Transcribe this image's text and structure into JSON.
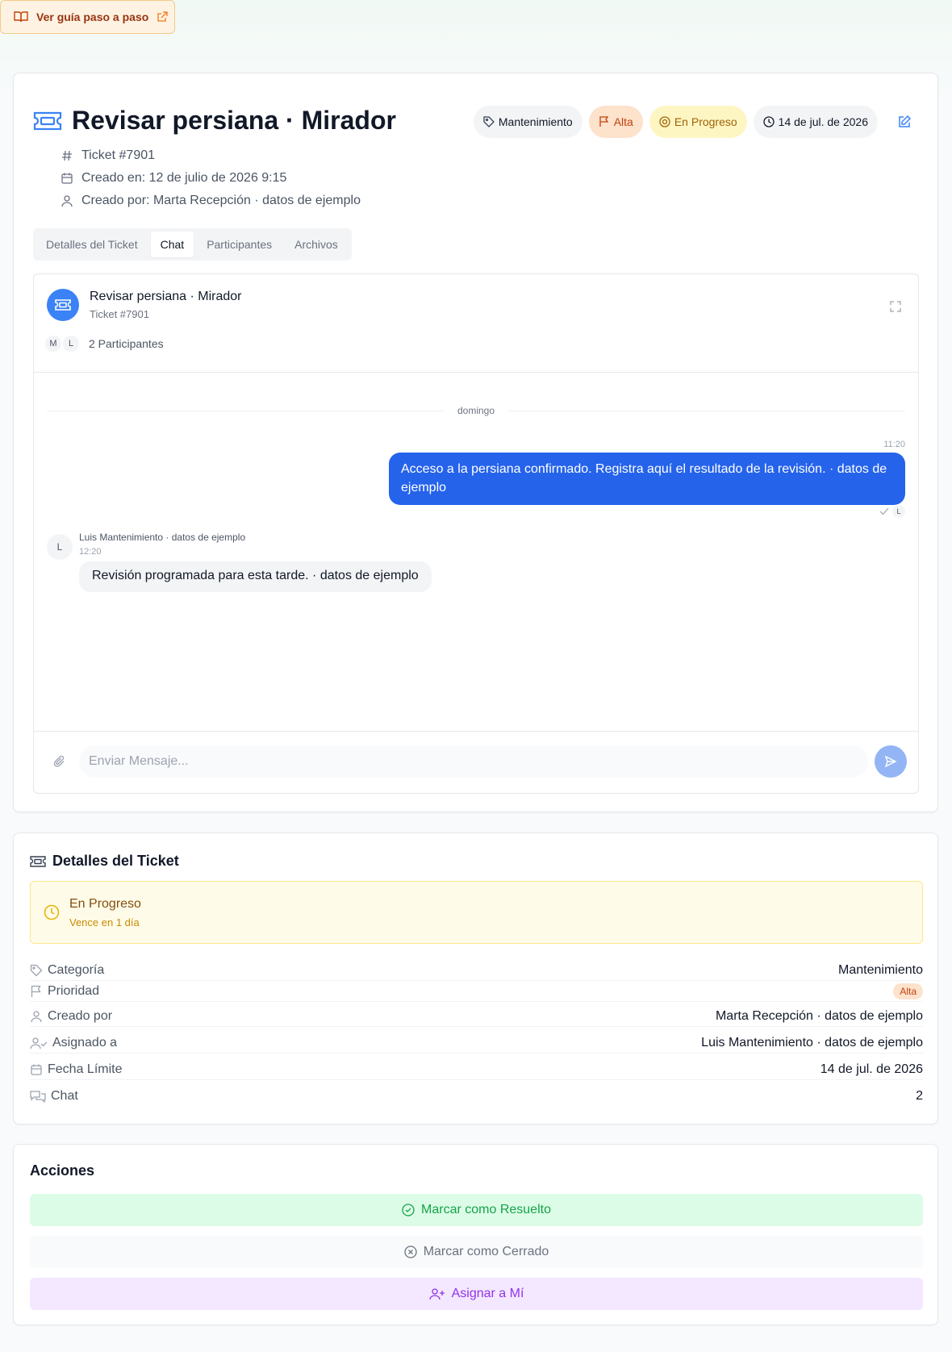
{
  "guide": {
    "label": "Ver guía paso a paso"
  },
  "ticket": {
    "title": "Revisar persiana · Mirador",
    "number": "Ticket #7901",
    "created_at": "Creado en: 12 de julio de 2026 9:15",
    "created_by": "Creado por: Marta Recepción · datos de ejemplo"
  },
  "badges": {
    "category": "Mantenimiento",
    "priority": "Alta",
    "status": "En Progreso",
    "due": "14 de jul. de 2026"
  },
  "tabs": [
    {
      "label": "Detalles del Ticket",
      "active": false
    },
    {
      "label": "Chat",
      "active": true
    },
    {
      "label": "Participantes",
      "active": false
    },
    {
      "label": "Archivos",
      "active": false
    }
  ],
  "chat": {
    "title": "Revisar persiana · Mirador",
    "subtitle": "Ticket #7901",
    "participants": [
      "M",
      "L"
    ],
    "participants_label": "2 Participantes",
    "day_label": "domingo",
    "messages": [
      {
        "direction": "out",
        "time": "11:20",
        "text": "Acceso a la persiana confirmado. Registra aquí el resultado de la revisión. · datos de ejemplo",
        "read_by": "L"
      },
      {
        "direction": "in",
        "avatar": "L",
        "author": "Luis Mantenimiento · datos de ejemplo",
        "time": "12:20",
        "text": "Revisión programada para esta tarde. · datos de ejemplo"
      }
    ],
    "input_placeholder": "Enviar Mensaje..."
  },
  "details": {
    "title": "Detalles del Ticket",
    "status_title": "En Progreso",
    "status_sub": "Vence en 1 día",
    "rows": [
      {
        "label": "Categoría",
        "value": "Mantenimiento"
      },
      {
        "label": "Prioridad",
        "value": "Alta"
      },
      {
        "label": "Creado por",
        "value": "Marta Recepción · datos de ejemplo"
      },
      {
        "label": "Asignado a",
        "value": "Luis Mantenimiento · datos de ejemplo"
      },
      {
        "label": "Fecha Límite",
        "value": "14 de jul. de 2026"
      },
      {
        "label": "Chat",
        "value": "2"
      }
    ]
  },
  "actions": {
    "title": "Acciones",
    "resolve": "Marcar como Resuelto",
    "close": "Marcar como Cerrado",
    "assign": "Asignar a Mí"
  },
  "colors": {
    "primary": "#2563eb",
    "priority_bg": "#fde2cc",
    "status_bg": "#fdf6c3",
    "resolve_bg": "#dcfce7",
    "assign_bg": "#f3e8ff"
  }
}
